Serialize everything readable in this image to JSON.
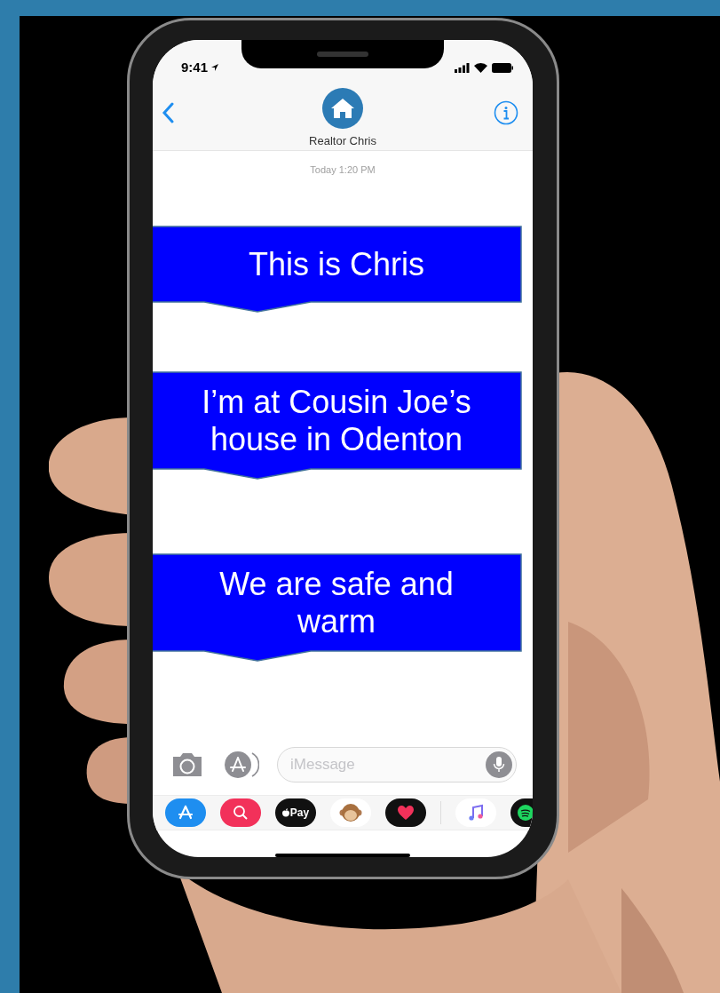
{
  "status_bar": {
    "time": "9:41"
  },
  "header": {
    "contact": "Realtor Chris"
  },
  "timestamp": "Today 1:20 PM",
  "messages": [
    {
      "text": "This is Chris"
    },
    {
      "text": "I’m at Cousin Joe’s house in Odenton"
    },
    {
      "text": "We are safe and warm"
    }
  ],
  "composer": {
    "placeholder": "iMessage"
  },
  "app_drawer": [
    {
      "kind": "store"
    },
    {
      "kind": "search"
    },
    {
      "kind": "pay",
      "label": "Pay"
    },
    {
      "kind": "animal"
    },
    {
      "kind": "heart"
    },
    {
      "kind": "divider"
    },
    {
      "kind": "music"
    },
    {
      "kind": "spotify"
    }
  ]
}
